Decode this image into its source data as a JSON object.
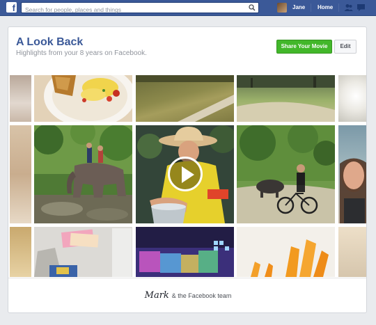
{
  "topbar": {
    "logo": "f",
    "search_placeholder": "Search for people, places and things",
    "user_name": "Jane",
    "home_label": "Home"
  },
  "card": {
    "title": "A Look Back",
    "subtitle": "Highlights from your 8 years on Facebook.",
    "share_button": "Share Your Movie",
    "edit_button": "Edit"
  },
  "footer": {
    "signature": "Mark",
    "text": "& the Facebook team"
  },
  "colors": {
    "brand_blue": "#3b5998",
    "share_green": "#42b72a"
  },
  "icons": [
    "facebook-logo-icon",
    "search-icon",
    "friend-requests-icon",
    "messages-icon",
    "play-icon"
  ]
}
